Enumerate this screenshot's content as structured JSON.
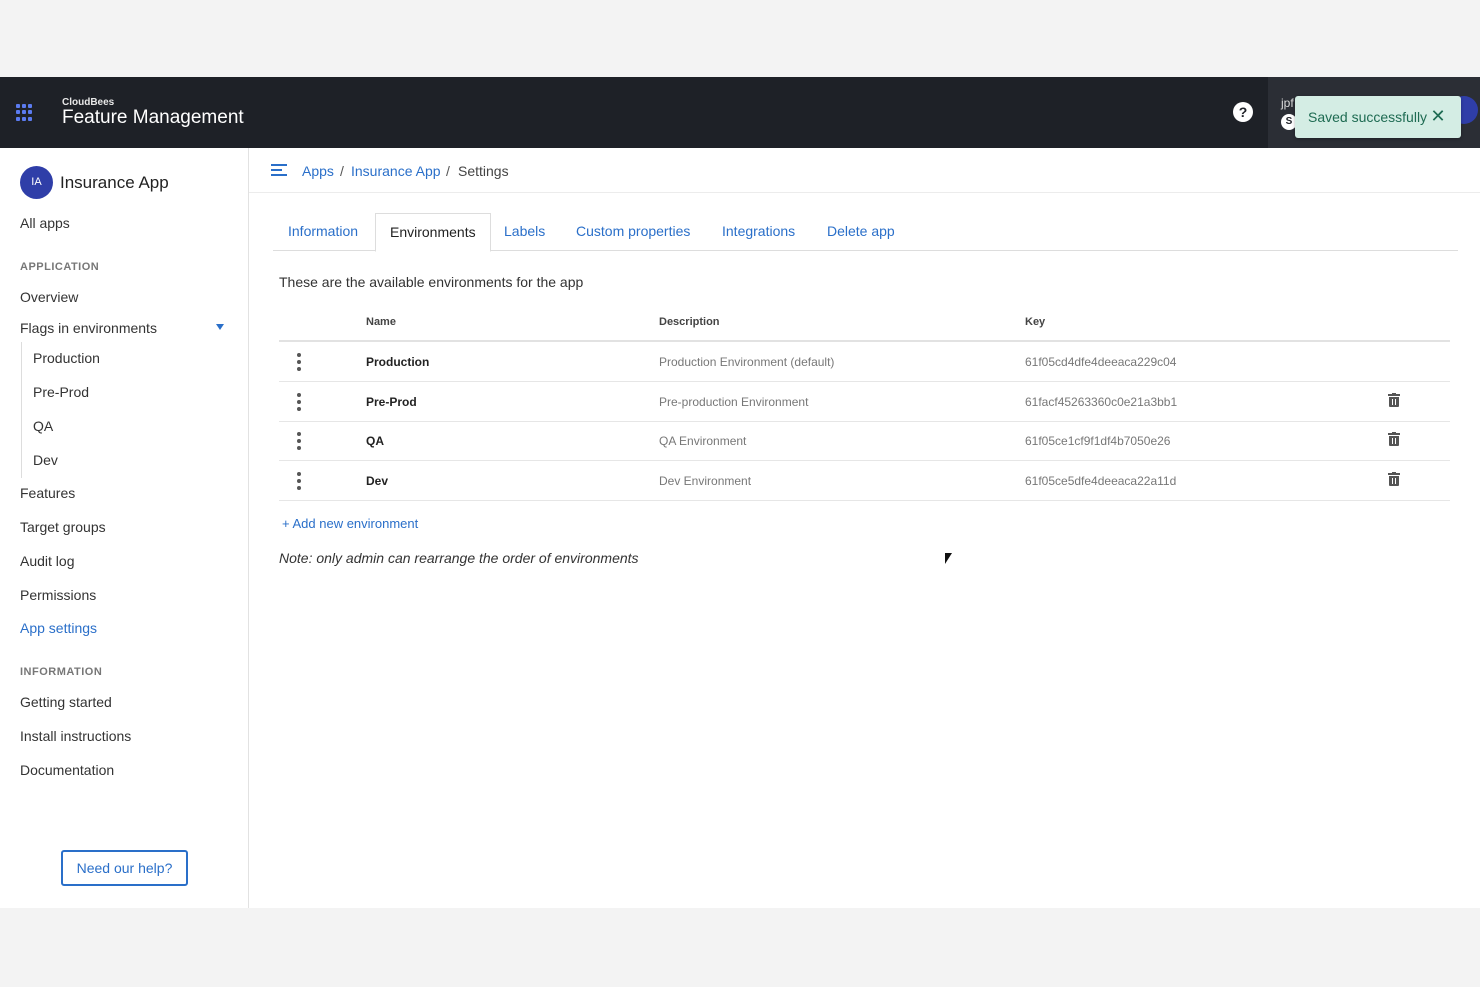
{
  "topbar": {
    "brand_small": "CloudBees",
    "brand_big": "Feature Management",
    "help_glyph": "?",
    "user_name": "jpf",
    "user_badge": "S"
  },
  "toast": {
    "message": "Saved successfully",
    "close_glyph": "✕"
  },
  "sidebar": {
    "app_initials": "IA",
    "app_name": "Insurance App",
    "all_apps": "All apps",
    "section_application": "APPLICATION",
    "overview": "Overview",
    "flags_in_environments": "Flags in environments",
    "environments": [
      "Production",
      "Pre-Prod",
      "QA",
      "Dev"
    ],
    "features": "Features",
    "target_groups": "Target groups",
    "audit_log": "Audit log",
    "permissions": "Permissions",
    "app_settings": "App settings",
    "section_information": "INFORMATION",
    "getting_started": "Getting started",
    "install_instructions": "Install instructions",
    "documentation": "Documentation",
    "help_button": "Need our help?"
  },
  "breadcrumb": {
    "apps": "Apps",
    "app": "Insurance App",
    "current": "Settings",
    "separator": "/"
  },
  "tabs": [
    {
      "label": "Information",
      "active": false
    },
    {
      "label": "Environments",
      "active": true
    },
    {
      "label": "Labels",
      "active": false
    },
    {
      "label": "Custom properties",
      "active": false
    },
    {
      "label": "Integrations",
      "active": false
    },
    {
      "label": "Delete app",
      "active": false
    }
  ],
  "environments_page": {
    "intro": "These are the available environments for the app",
    "columns": {
      "name": "Name",
      "description": "Description",
      "key": "Key"
    },
    "rows": [
      {
        "name": "Production",
        "description": "Production Environment (default)",
        "key": "61f05cd4dfe4deeaca229c04",
        "deletable": false
      },
      {
        "name": "Pre-Prod",
        "description": "Pre-production Environment",
        "key": "61facf45263360c0e21a3bb1",
        "deletable": true
      },
      {
        "name": "QA",
        "description": "QA Environment",
        "key": "61f05ce1cf9f1df4b7050e26",
        "deletable": true
      },
      {
        "name": "Dev",
        "description": "Dev Environment",
        "key": "61f05ce5dfe4deeaca22a11d",
        "deletable": true
      }
    ],
    "add_link": "+ Add new environment",
    "note": "Note: only admin can rearrange the order of environments"
  },
  "colors": {
    "topbar_bg": "#1e2127",
    "accent_blue": "#2a6fc9",
    "avatar_indigo": "#2f3ea8",
    "toast_bg": "#d4ede4",
    "toast_text": "#1e6b52"
  }
}
